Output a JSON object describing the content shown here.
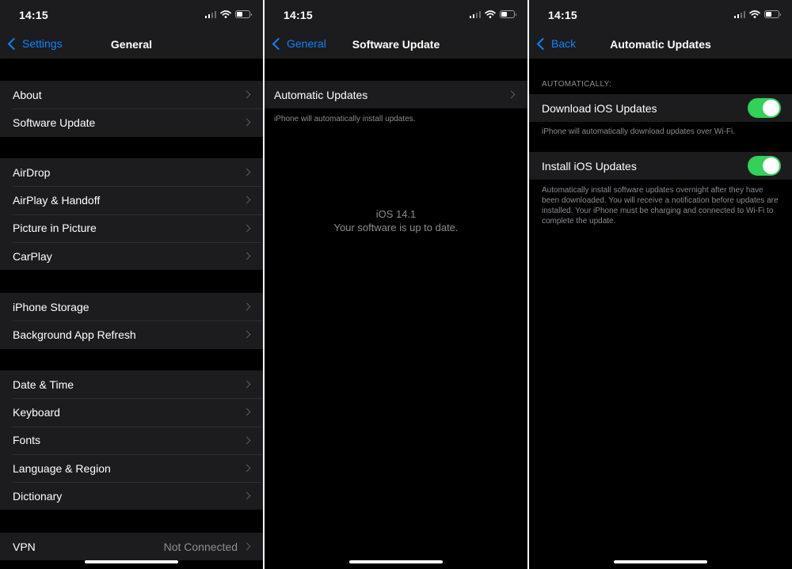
{
  "status": {
    "time": "14:15"
  },
  "screen1": {
    "back_label": "Settings",
    "title": "General",
    "groups": [
      [
        "About",
        "Software Update"
      ],
      [
        "AirDrop",
        "AirPlay & Handoff",
        "Picture in Picture",
        "CarPlay"
      ],
      [
        "iPhone Storage",
        "Background App Refresh"
      ],
      [
        "Date & Time",
        "Keyboard",
        "Fonts",
        "Language & Region",
        "Dictionary"
      ]
    ],
    "vpn": {
      "label": "VPN",
      "value": "Not Connected"
    }
  },
  "screen2": {
    "back_label": "General",
    "title": "Software Update",
    "automatic_updates_label": "Automatic Updates",
    "automatic_updates_note": "iPhone will automatically install updates.",
    "ios_version": "iOS 14.1",
    "up_to_date": "Your software is up to date."
  },
  "screen3": {
    "back_label": "Back",
    "title": "Automatic Updates",
    "section_header": "AUTOMATICALLY:",
    "download_label": "Download iOS Updates",
    "download_on": true,
    "download_note": "iPhone will automatically download updates over Wi-Fi.",
    "install_label": "Install iOS Updates",
    "install_on": true,
    "install_note": "Automatically install software updates overnight after they have been downloaded. You will receive a notification before updates are installed. Your iPhone must be charging and connected to Wi-Fi to complete the update."
  },
  "colors": {
    "accent": "#0a84ff",
    "toggle_on": "#32d158",
    "background": "#000000",
    "cell": "#1c1c1e",
    "secondary_text": "#8d8d93"
  },
  "icons": [
    "signal-icon",
    "wifi-icon",
    "battery-icon",
    "back-chevron-icon",
    "disclosure-chevron-icon"
  ]
}
